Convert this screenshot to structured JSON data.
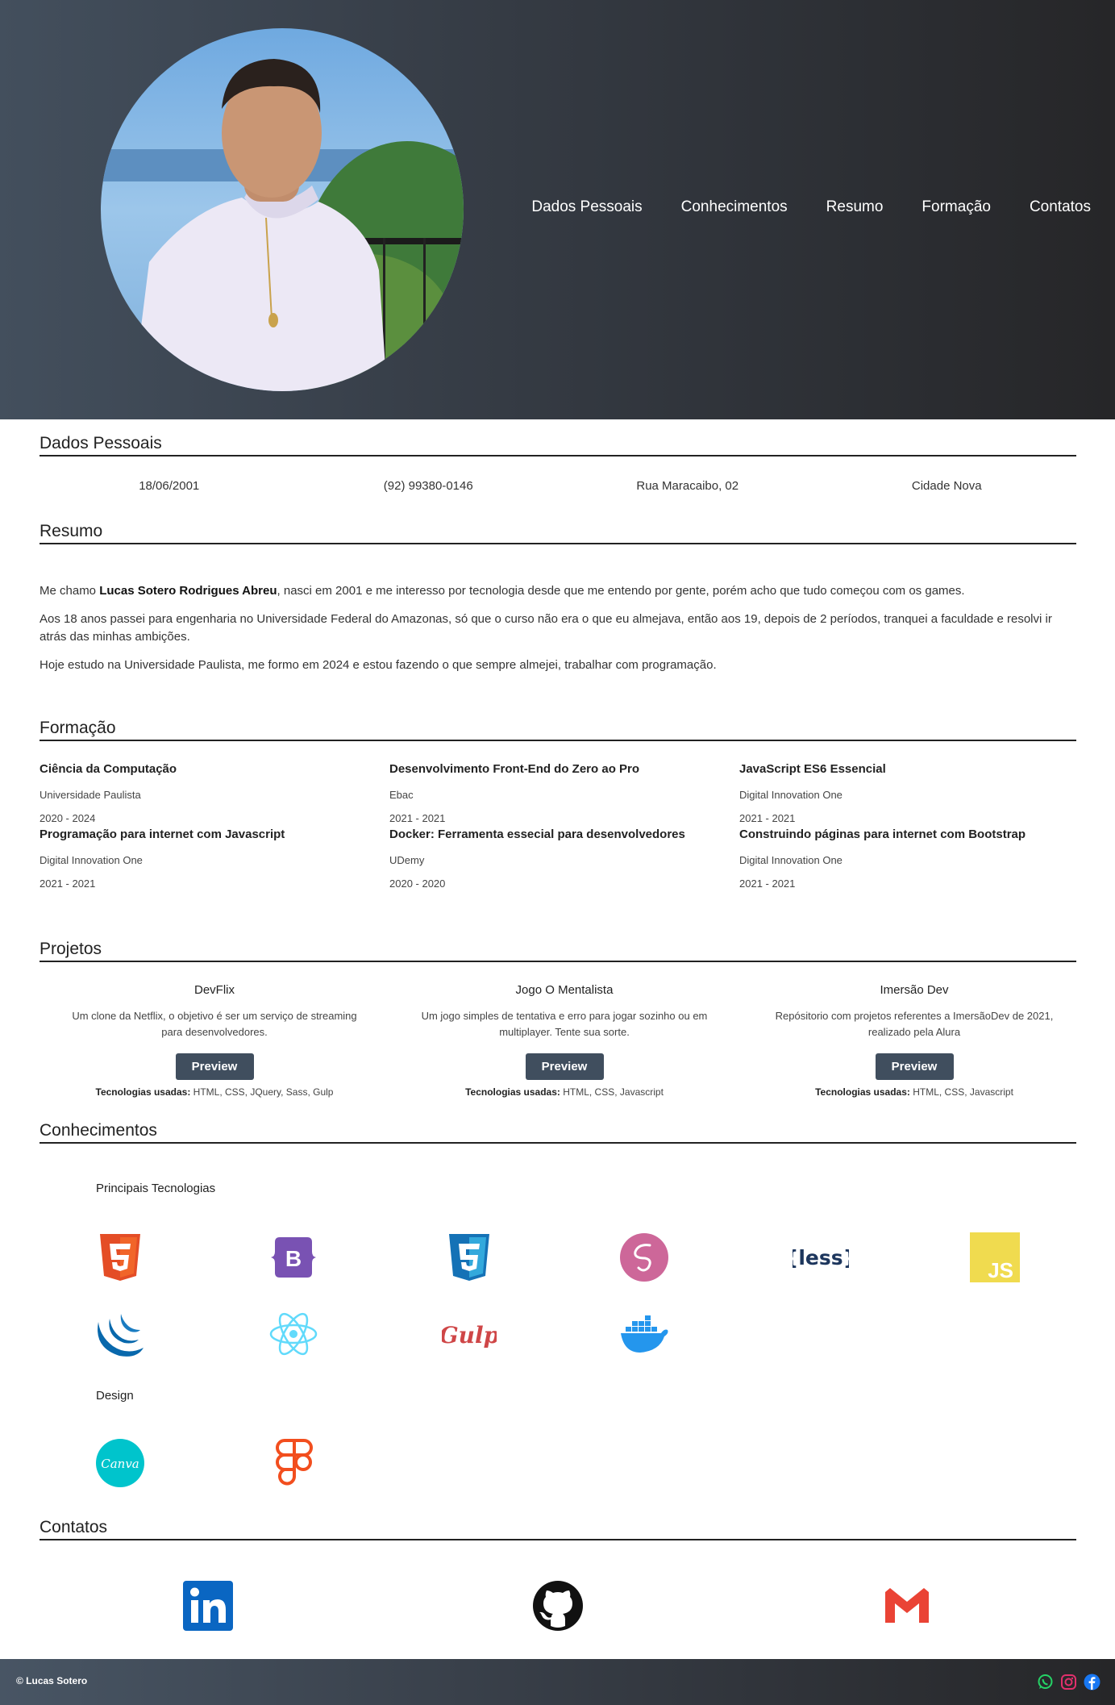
{
  "nav": {
    "items": [
      "Dados Pessoais",
      "Conhecimentos",
      "Resumo",
      "Formação",
      "Contatos"
    ]
  },
  "dados_pessoais": {
    "title": "Dados Pessoais",
    "birth_date": "18/06/2001",
    "phone": "(92) 99380-0146",
    "street": "Rua Maracaibo, 02",
    "district": "Cidade Nova"
  },
  "resumo": {
    "title": "Resumo",
    "p1_before": "Me chamo ",
    "p1_name": "Lucas Sotero Rodrigues Abreu",
    "p1_after": ", nasci em 2001 e me interesso por tecnologia desde que me entendo por gente, porém acho que tudo começou com os games.",
    "p2": "Aos 18 anos passei para engenharia no Universidade Federal do Amazonas, só que o curso não era o que eu almejava, então aos 19, depois de 2 períodos, tranquei a faculdade e resolvi ir atrás das minhas ambições.",
    "p3": "Hoje estudo na Universidade Paulista, me formo em 2024 e estou fazendo o que sempre almejei, trabalhar com programação."
  },
  "formacao": {
    "title": "Formação",
    "courses": [
      {
        "name": "Ciência da Computação",
        "institution": "Universidade Paulista",
        "years": "2020 - 2024"
      },
      {
        "name": "Desenvolvimento Front-End do Zero ao Pro",
        "institution": "Ebac",
        "years": "2021 - 2021"
      },
      {
        "name": "JavaScript ES6 Essencial",
        "institution": "Digital Innovation One",
        "years": "2021 - 2021"
      },
      {
        "name": "Programação para internet com Javascript",
        "institution": "Digital Innovation One",
        "years": "2021 - 2021"
      },
      {
        "name": "Docker: Ferramenta essecial para desenvolvedores",
        "institution": "UDemy",
        "years": "2020 - 2020"
      },
      {
        "name": "Construindo páginas para internet com Bootstrap",
        "institution": "Digital Innovation One",
        "years": "2021 - 2021"
      }
    ]
  },
  "projetos": {
    "title": "Projetos",
    "tech_label": "Tecnologias usadas:",
    "items": [
      {
        "name": "DevFlix",
        "description": "Um clone da Netflix, o objetivo é ser um serviço de streaming para desenvolvedores.",
        "button": "Preview",
        "tech": " HTML, CSS, JQuery, Sass, Gulp"
      },
      {
        "name": "Jogo O Mentalista",
        "description": "Um jogo simples de tentativa e erro para jogar sozinho ou em multiplayer. Tente sua sorte.",
        "button": "Preview",
        "tech": " HTML, CSS, Javascript"
      },
      {
        "name": "Imersão Dev",
        "description": "Repósitorio com projetos referentes a ImersãoDev de 2021, realizado pela Alura",
        "button": "Preview",
        "tech": " HTML, CSS, Javascript"
      }
    ]
  },
  "conhecimentos": {
    "title": "Conhecimentos",
    "main_label": "Principais Tecnologias",
    "design_label": "Design",
    "icons": {
      "less_text": "{less}",
      "js_text": "JS",
      "gulp_text": "Gulp",
      "canva_text": "Canva",
      "bootstrap_text": "B"
    }
  },
  "contatos": {
    "title": "Contatos"
  },
  "footer": {
    "copyright": "© Lucas Sotero"
  }
}
